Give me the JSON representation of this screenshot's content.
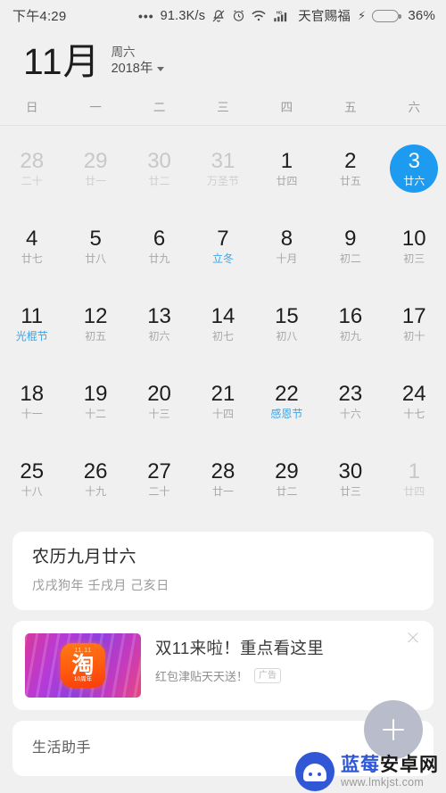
{
  "status_bar": {
    "time": "下午4:29",
    "dots": "•••",
    "network_speed": "91.3K/s",
    "icons": [
      "bell-muted-icon",
      "alarm-icon",
      "wifi-icon",
      "signal-hd-icon"
    ],
    "carrier": "天官赐福",
    "charging_icon": "bolt-icon",
    "battery_percent": "36%",
    "battery_level": 36,
    "battery_color": "#3ec63e"
  },
  "header": {
    "month": "11月",
    "weekday": "周六",
    "year": "2018年",
    "dropdown_icon": "chevron-down-icon"
  },
  "weekdays": [
    "日",
    "一",
    "二",
    "三",
    "四",
    "五",
    "六"
  ],
  "accent_color": "#1d9bf0",
  "calendar": {
    "rows": [
      [
        {
          "day": "28",
          "lunar": "二十",
          "other": true,
          "festival": false,
          "selected": false
        },
        {
          "day": "29",
          "lunar": "廿一",
          "other": true,
          "festival": false,
          "selected": false
        },
        {
          "day": "30",
          "lunar": "廿二",
          "other": true,
          "festival": false,
          "selected": false
        },
        {
          "day": "31",
          "lunar": "万圣节",
          "other": true,
          "festival": false,
          "selected": false
        },
        {
          "day": "1",
          "lunar": "廿四",
          "other": false,
          "festival": false,
          "selected": false
        },
        {
          "day": "2",
          "lunar": "廿五",
          "other": false,
          "festival": false,
          "selected": false
        },
        {
          "day": "3",
          "lunar": "廿六",
          "other": false,
          "festival": false,
          "selected": true
        }
      ],
      [
        {
          "day": "4",
          "lunar": "廿七",
          "other": false,
          "festival": false,
          "selected": false
        },
        {
          "day": "5",
          "lunar": "廿八",
          "other": false,
          "festival": false,
          "selected": false
        },
        {
          "day": "6",
          "lunar": "廿九",
          "other": false,
          "festival": false,
          "selected": false
        },
        {
          "day": "7",
          "lunar": "立冬",
          "other": false,
          "festival": true,
          "selected": false
        },
        {
          "day": "8",
          "lunar": "十月",
          "other": false,
          "festival": false,
          "selected": false
        },
        {
          "day": "9",
          "lunar": "初二",
          "other": false,
          "festival": false,
          "selected": false
        },
        {
          "day": "10",
          "lunar": "初三",
          "other": false,
          "festival": false,
          "selected": false
        }
      ],
      [
        {
          "day": "11",
          "lunar": "光棍节",
          "other": false,
          "festival": true,
          "selected": false
        },
        {
          "day": "12",
          "lunar": "初五",
          "other": false,
          "festival": false,
          "selected": false
        },
        {
          "day": "13",
          "lunar": "初六",
          "other": false,
          "festival": false,
          "selected": false
        },
        {
          "day": "14",
          "lunar": "初七",
          "other": false,
          "festival": false,
          "selected": false
        },
        {
          "day": "15",
          "lunar": "初八",
          "other": false,
          "festival": false,
          "selected": false
        },
        {
          "day": "16",
          "lunar": "初九",
          "other": false,
          "festival": false,
          "selected": false
        },
        {
          "day": "17",
          "lunar": "初十",
          "other": false,
          "festival": false,
          "selected": false
        }
      ],
      [
        {
          "day": "18",
          "lunar": "十一",
          "other": false,
          "festival": false,
          "selected": false
        },
        {
          "day": "19",
          "lunar": "十二",
          "other": false,
          "festival": false,
          "selected": false
        },
        {
          "day": "20",
          "lunar": "十三",
          "other": false,
          "festival": false,
          "selected": false
        },
        {
          "day": "21",
          "lunar": "十四",
          "other": false,
          "festival": false,
          "selected": false
        },
        {
          "day": "22",
          "lunar": "感恩节",
          "other": false,
          "festival": true,
          "selected": false
        },
        {
          "day": "23",
          "lunar": "十六",
          "other": false,
          "festival": false,
          "selected": false
        },
        {
          "day": "24",
          "lunar": "十七",
          "other": false,
          "festival": false,
          "selected": false
        }
      ],
      [
        {
          "day": "25",
          "lunar": "十八",
          "other": false,
          "festival": false,
          "selected": false
        },
        {
          "day": "26",
          "lunar": "十九",
          "other": false,
          "festival": false,
          "selected": false
        },
        {
          "day": "27",
          "lunar": "二十",
          "other": false,
          "festival": false,
          "selected": false
        },
        {
          "day": "28",
          "lunar": "廿一",
          "other": false,
          "festival": false,
          "selected": false
        },
        {
          "day": "29",
          "lunar": "廿二",
          "other": false,
          "festival": false,
          "selected": false
        },
        {
          "day": "30",
          "lunar": "廿三",
          "other": false,
          "festival": false,
          "selected": false
        },
        {
          "day": "1",
          "lunar": "廿四",
          "other": true,
          "festival": false,
          "selected": false
        }
      ]
    ]
  },
  "lunar_card": {
    "title": "农历九月廿六",
    "subtitle": "戊戌狗年 壬戌月 己亥日"
  },
  "ad_card": {
    "thumb_badge": "11.11",
    "thumb_char": "淘",
    "thumb_anniversary": "10周年",
    "title": "双11来啦！重点看这里",
    "subtitle": "红包津贴天天送！",
    "tag": "广告",
    "close_icon": "close-icon"
  },
  "assistant_card": {
    "title": "生活助手"
  },
  "fab": {
    "icon": "plus-icon"
  },
  "watermark": {
    "name_blue": "蓝莓",
    "name_dark": "安卓网",
    "url": "www.lmkjst.com",
    "logo_icon": "android-robot-icon"
  }
}
